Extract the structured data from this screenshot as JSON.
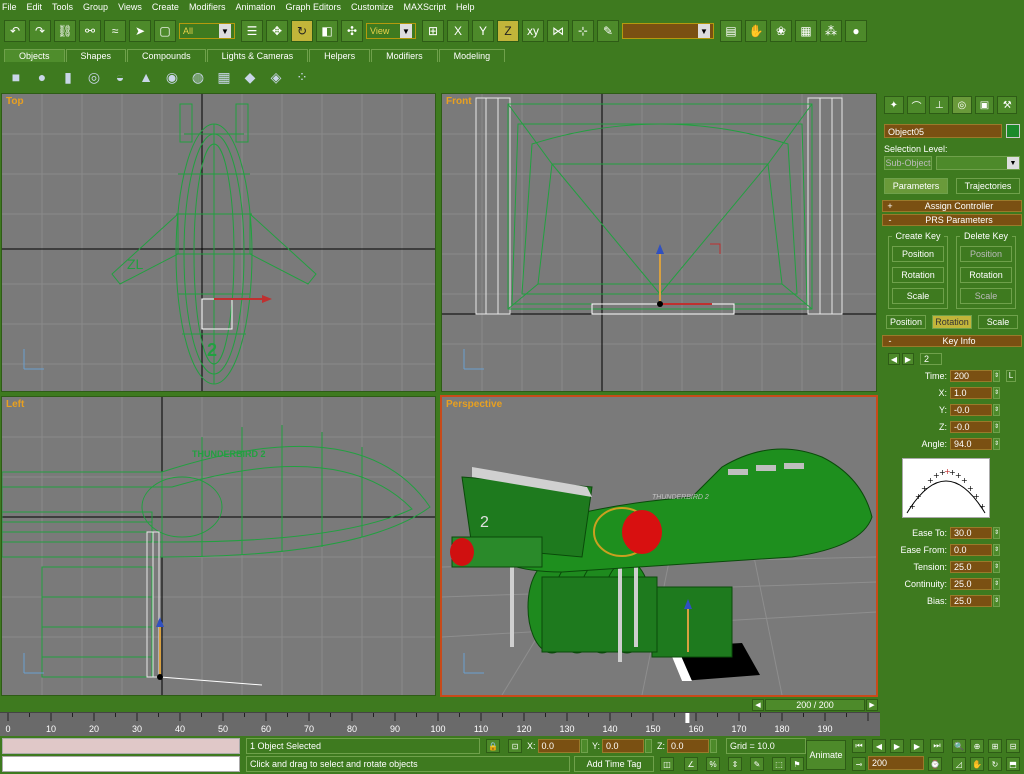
{
  "menu": [
    "File",
    "Edit",
    "Tools",
    "Group",
    "Views",
    "Create",
    "Modifiers",
    "Animation",
    "Graph Editors",
    "Customize",
    "MAXScript",
    "Help"
  ],
  "toolbar": {
    "selection_filter": "All",
    "ref_coord": "View",
    "named_selection": ""
  },
  "tabs": [
    "Objects",
    "Shapes",
    "Compounds",
    "Lights & Cameras",
    "Helpers",
    "Modifiers",
    "Modeling"
  ],
  "active_tab": "Objects",
  "viewports": {
    "top": "Top",
    "front": "Front",
    "left": "Left",
    "perspective": "Perspective",
    "decal_text_top": "ZL",
    "decal_num_top": "2",
    "decal_text_left": "THUNDERBIRD 2",
    "decal_text_persp": "THUNDERBIRD 2",
    "decal_num_persp": "2"
  },
  "command_panel": {
    "object_name": "Object05",
    "selection_level_label": "Selection Level:",
    "sub_object_label": "Sub-Object",
    "parameters_label": "Parameters",
    "trajectories_label": "Trajectories",
    "assign_controller": "Assign Controller",
    "prs_parameters": "PRS Parameters",
    "create_key": "Create Key",
    "delete_key": "Delete Key",
    "position": "Position",
    "rotation": "Rotation",
    "scale": "Scale",
    "key_info": "Key Info",
    "key_number": "2",
    "time_label": "Time:",
    "time_value": "200",
    "lock_label": "L",
    "x_label": "X:",
    "x_value": "1.0",
    "y_label": "Y:",
    "y_value": "-0.0",
    "z_label": "Z:",
    "z_value": "-0.0",
    "angle_label": "Angle:",
    "angle_value": "94.0",
    "ease_to_label": "Ease To:",
    "ease_to_value": "30.0",
    "ease_from_label": "Ease From:",
    "ease_from_value": "0.0",
    "tension_label": "Tension:",
    "tension_value": "25.0",
    "continuity_label": "Continuity:",
    "continuity_value": "25.0",
    "bias_label": "Bias:",
    "bias_value": "25.0"
  },
  "timeline": {
    "slider_label": "200 / 200",
    "ticks": [
      "0",
      "10",
      "20",
      "30",
      "40",
      "50",
      "60",
      "70",
      "80",
      "90",
      "100",
      "110",
      "120",
      "130",
      "140",
      "150",
      "160",
      "170",
      "180",
      "190"
    ],
    "current_frame_marker": 158
  },
  "status": {
    "selection": "1 Object Selected",
    "message": "Click and drag to select and rotate objects",
    "x_value": "0.0",
    "y_value": "0.0",
    "z_value": "0.0",
    "grid": "Grid = 10.0",
    "add_time_tag": "Add Time Tag",
    "animate": "Animate",
    "frame": "200"
  },
  "colors": {
    "ui_green": "#3e7a1f",
    "field_brown": "#7a5012",
    "label_orange": "#e8a020",
    "wire_green": "#22a040",
    "active_border": "#c84a1a"
  }
}
